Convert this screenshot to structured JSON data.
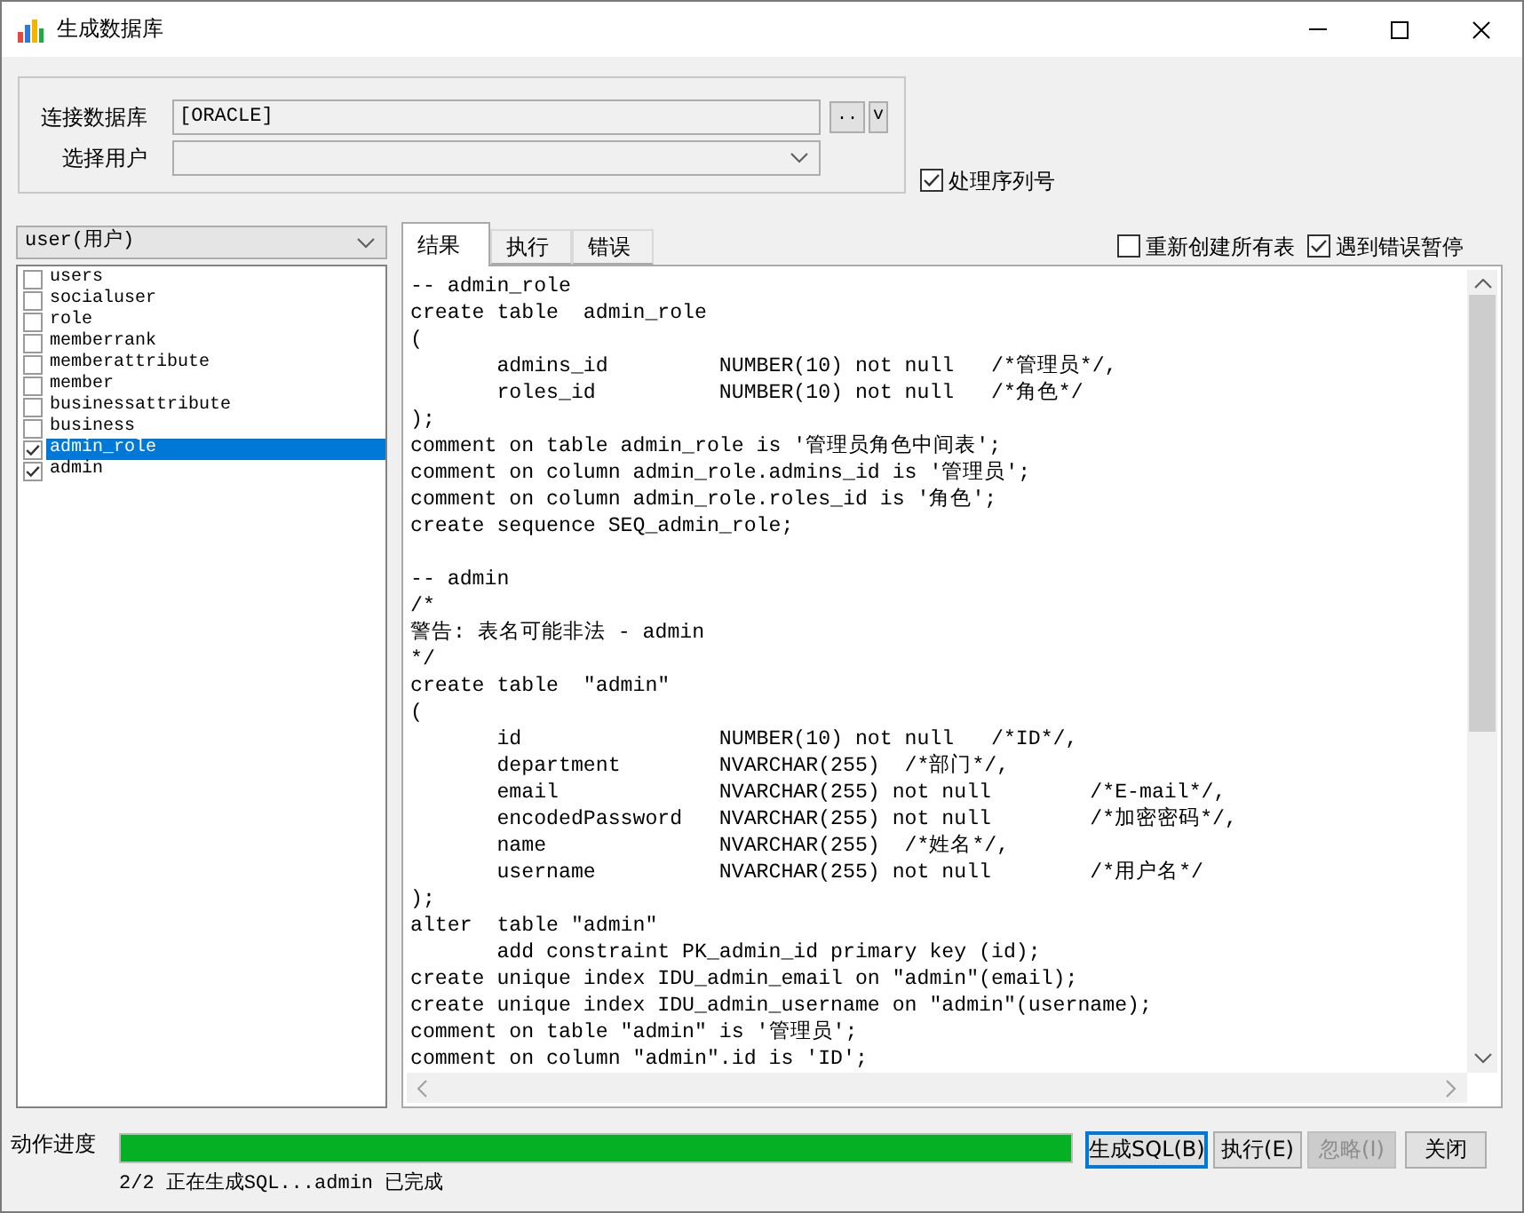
{
  "window": {
    "title": "生成数据库"
  },
  "connection": {
    "fields": [
      {
        "kind": "text",
        "label": "连接数据库",
        "value": "[ORACLE]",
        "buttons": [
          "..",
          "v"
        ]
      },
      {
        "kind": "dropdown",
        "label": "选择用户"
      }
    ]
  },
  "process_sequence": {
    "label": "处理序列号",
    "checked": true
  },
  "schema_select": {
    "value": "user(用户)"
  },
  "tables": [
    {
      "name": "users",
      "checked": false,
      "selected": false
    },
    {
      "name": "socialuser",
      "checked": false,
      "selected": false
    },
    {
      "name": "role",
      "checked": false,
      "selected": false
    },
    {
      "name": "memberrank",
      "checked": false,
      "selected": false
    },
    {
      "name": "memberattribute",
      "checked": false,
      "selected": false
    },
    {
      "name": "member",
      "checked": false,
      "selected": false
    },
    {
      "name": "businessattribute",
      "checked": false,
      "selected": false
    },
    {
      "name": "business",
      "checked": false,
      "selected": false
    },
    {
      "name": "admin_role",
      "checked": true,
      "selected": true
    },
    {
      "name": "admin",
      "checked": true,
      "selected": false
    }
  ],
  "tabs": [
    {
      "label": "结果",
      "selected": true
    },
    {
      "label": "执行",
      "selected": false
    },
    {
      "label": "错误",
      "selected": false
    }
  ],
  "options": [
    {
      "label": "重新创建所有表",
      "checked": false
    },
    {
      "label": "遇到错误暂停",
      "checked": true
    }
  ],
  "code_blocks": [
    [
      "-- admin_role",
      "create table  admin_role",
      "(",
      "       admins_id         NUMBER(10) not null   /*管理员*/,",
      "       roles_id          NUMBER(10) not null   /*角色*/",
      ");",
      "comment on table admin_role is '管理员角色中间表';",
      "comment on column admin_role.admins_id is '管理员';",
      "comment on column admin_role.roles_id is '角色';",
      "create sequence SEQ_admin_role;"
    ],
    [
      "-- admin",
      "/*",
      "警告: 表名可能非法 - admin",
      "*/",
      "create table  \"admin\"",
      "(",
      "       id                NUMBER(10) not null   /*ID*/,",
      "       department        NVARCHAR(255)  /*部门*/,",
      "       email             NVARCHAR(255) not null        /*E-mail*/,",
      "       encodedPassword   NVARCHAR(255) not null        /*加密密码*/,",
      "       name              NVARCHAR(255)  /*姓名*/,",
      "       username          NVARCHAR(255) not null        /*用户名*/",
      ");",
      "alter  table \"admin\"",
      "       add constraint PK_admin_id primary key (id);",
      "create unique index IDU_admin_email on \"admin\"(email);",
      "create unique index IDU_admin_username on \"admin\"(username);",
      "comment on table \"admin\" is '管理员';",
      "comment on column \"admin\".id is 'ID';"
    ]
  ],
  "progress": {
    "label": "动作进度",
    "level": 1,
    "status": "2/2 正在生成SQL...admin 已完成"
  },
  "buttons": [
    {
      "label": "生成SQL(B)",
      "focused": true,
      "disabled": false
    },
    {
      "label": "执行(E)",
      "focused": false,
      "disabled": false
    },
    {
      "label": "忽略(I)",
      "focused": false,
      "disabled": true
    },
    {
      "label": "关闭",
      "focused": false,
      "disabled": false
    }
  ]
}
